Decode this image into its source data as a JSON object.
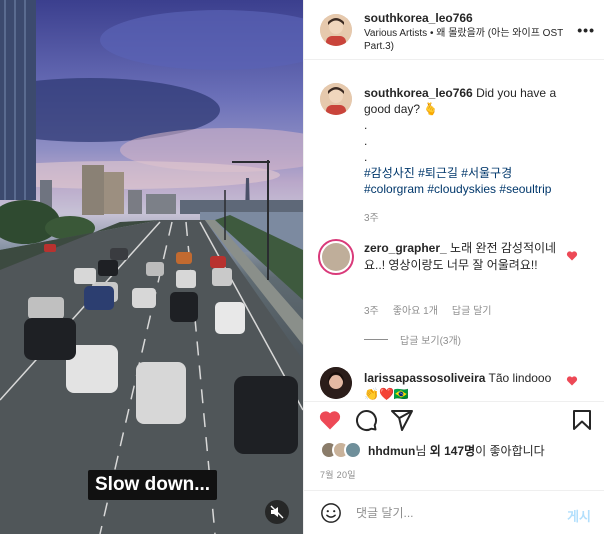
{
  "media": {
    "overlay_caption": "Slow down...",
    "mute_icon": "muted-speaker-icon"
  },
  "header": {
    "username": "southkorea_leo766",
    "song": "Various Artists • 왜 몰랐을까 (아는 와이프 OST Part.3)",
    "more_icon": "•••"
  },
  "caption": {
    "username": "southkorea_leo766",
    "text": "Did you have a good day? 🫰",
    "dots": ".\n.\n.",
    "tags_line1": "#감성사진 #퇴근길 #서울구경",
    "tags_line2": "#colorgram #cloudyskies #seoultrip",
    "time": "3주"
  },
  "comments": [
    {
      "username": "zero_grapher_",
      "text": "노래 완전 감성적이네요..! 영상이랑도 너무 잘 어울려요!!",
      "time": "3주",
      "likes": "좋아요 1개",
      "reply": "답글 달기",
      "view_replies": "답글 보기(3개)"
    },
    {
      "username": "larissapassosoliveira",
      "text": "Tão lindooo 👏❤️🇧🇷"
    }
  ],
  "likes": {
    "user": "hhdmun",
    "suffix_1": "님 ",
    "others": "외 147명",
    "suffix_2": "이 좋아합니다"
  },
  "date": "7월 20일",
  "add_comment": {
    "placeholder": "댓글 달기...",
    "post_label": "게시"
  },
  "colors": {
    "like_red": "#ed4956",
    "link_blue": "#00376b",
    "post_disabled": "#b2dffc",
    "muted_gray": "#8e8e8e"
  }
}
